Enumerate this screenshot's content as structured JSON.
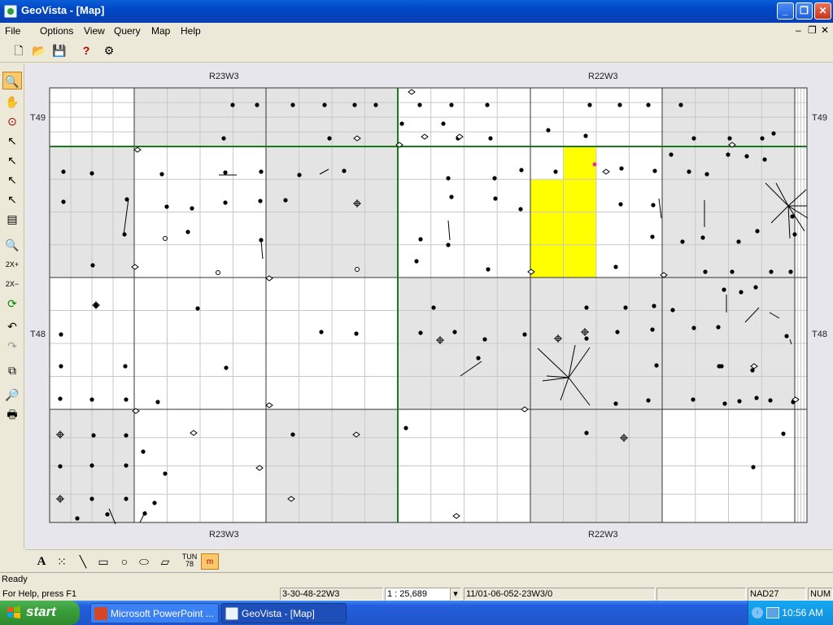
{
  "window": {
    "title": "GeoVista - [Map]"
  },
  "menu": {
    "items": [
      "File",
      "Options",
      "View",
      "Query",
      "Map",
      "Help"
    ]
  },
  "map": {
    "range_labels": [
      "R23W3",
      "R22W3"
    ],
    "township_labels": [
      "T49",
      "T48"
    ],
    "highlight_color": "#ffff00",
    "scale": "1 : 25,689"
  },
  "drawbar": {
    "text_tool": "A",
    "tun_label": "TUN\n78"
  },
  "status": {
    "ready": "Ready",
    "help": "For Help, press F1",
    "location": "3-30-48-22W3",
    "scale": "1 : 25,689",
    "well_id": "11/01-06-052-23W3/0",
    "datum": "NAD27",
    "num": "NUM"
  },
  "taskbar": {
    "start": "start",
    "tasks": [
      "Microsoft PowerPoint ...",
      "GeoVista - [Map]"
    ],
    "clock": "10:56 AM"
  }
}
